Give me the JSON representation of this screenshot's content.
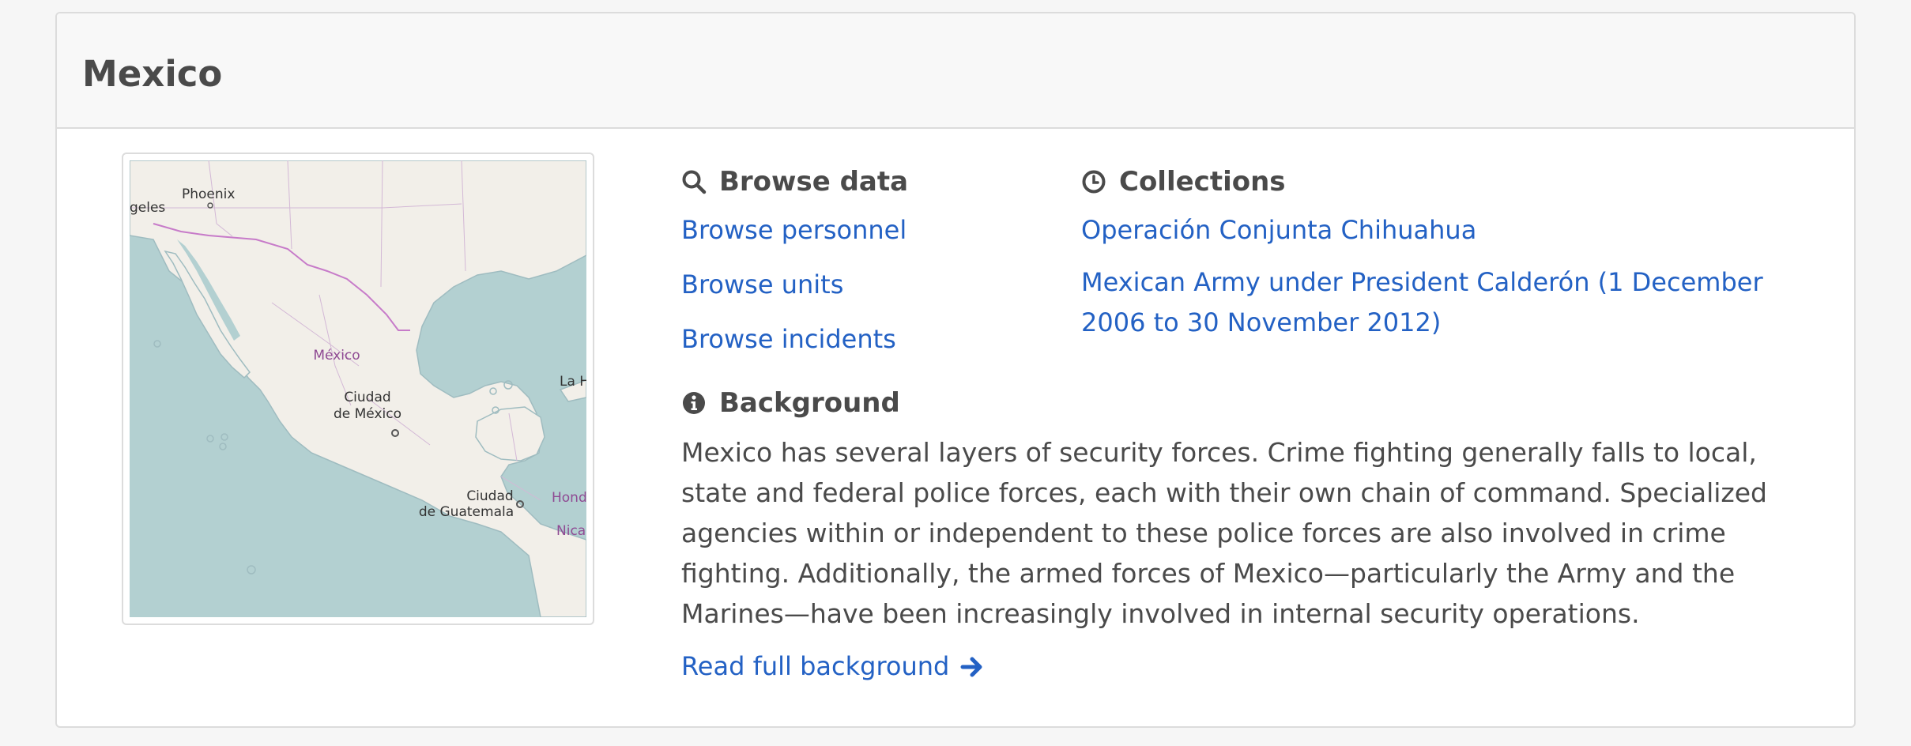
{
  "country": {
    "title": "Mexico"
  },
  "map": {
    "labels": {
      "phoenix": "Phoenix",
      "angeles": "geles",
      "mexico": "México",
      "cdmx_line1": "Ciudad",
      "cdmx_line2": "de México",
      "guatemala_line1": "Ciudad",
      "guatemala_line2": "de Guatemala",
      "habana": "La H",
      "honduras": "Hond",
      "nicaragua": "Nica"
    },
    "colors": {
      "water": "#b3d0d1",
      "land": "#f2efe9",
      "border": "#c77bc9"
    }
  },
  "browse": {
    "heading": "Browse data",
    "icon": "search-icon",
    "links": [
      "Browse personnel",
      "Browse units",
      "Browse incidents"
    ]
  },
  "collections": {
    "heading": "Collections",
    "icon": "clock-icon",
    "links": [
      "Operación Conjunta Chihuahua",
      "Mexican Army under President Calderón (1 December 2006 to 30 November 2012)"
    ]
  },
  "background": {
    "heading": "Background",
    "icon": "info-icon",
    "text": "Mexico has several layers of security forces. Crime fighting generally falls to local, state and federal police forces, each with their own chain of command. Specialized agencies within or independent to these police forces are also involved in crime fighting. Additionally, the armed forces of Mexico—particularly the Army and the Marines—have been increasingly involved in internal security operations.",
    "read_more": "Read full background",
    "read_more_icon": "arrow-right-icon"
  },
  "colors": {
    "link": "#2361c4",
    "text": "#4a4a4a"
  }
}
